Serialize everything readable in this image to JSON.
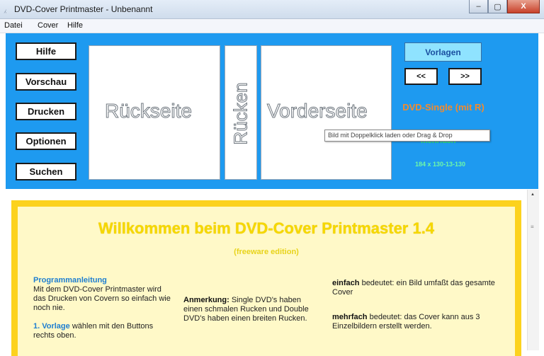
{
  "window": {
    "title": "DVD-Cover Printmaster - Unbenannt",
    "minimize": "‒",
    "maximize": "▢",
    "close": "X"
  },
  "menu": [
    "Datei",
    "Cover",
    "Hilfe"
  ],
  "left_buttons": [
    "Hilfe",
    "Vorschau",
    "Drucken",
    "Optionen",
    "Suchen"
  ],
  "canvas": {
    "back": "Rückseite",
    "spine": "Rücken",
    "front": "Vorderseite"
  },
  "tooltip": "Bild mit Doppelklick laden oder Drag & Drop",
  "right_panel": {
    "vorlagen": "Vorlagen",
    "prev": "<<",
    "next": ">>",
    "cover_type": "DVD-Single (mit R)",
    "mode": "mehrfach",
    "size": "184 x 130-13-130"
  },
  "content": {
    "welcome": "Willkommen beim DVD-Cover Printmaster 1.4",
    "edition": "(freeware edition)",
    "guide_head": "Programmanleitung",
    "guide_text": "Mit dem DVD-Cover Printmaster wird das Drucken von Covern so einfach wie noch nie.",
    "step1_head": "1. Vorlage",
    "step1_text": " wählen mit den Buttons rechts oben.",
    "note_head": "Anmerkung:",
    "note_text": " Single DVD's haben einen schmalen Rucken und Double DVD's haben einen breiten Rucken.",
    "simple_head": "einfach",
    "simple_text": " bedeutet: ein Bild umfaßt das gesamte Cover",
    "multi_head": "mehrfach",
    "multi_text": " bedeutet: das Cover kann aus 3 Einzelbildern erstellt werden."
  }
}
